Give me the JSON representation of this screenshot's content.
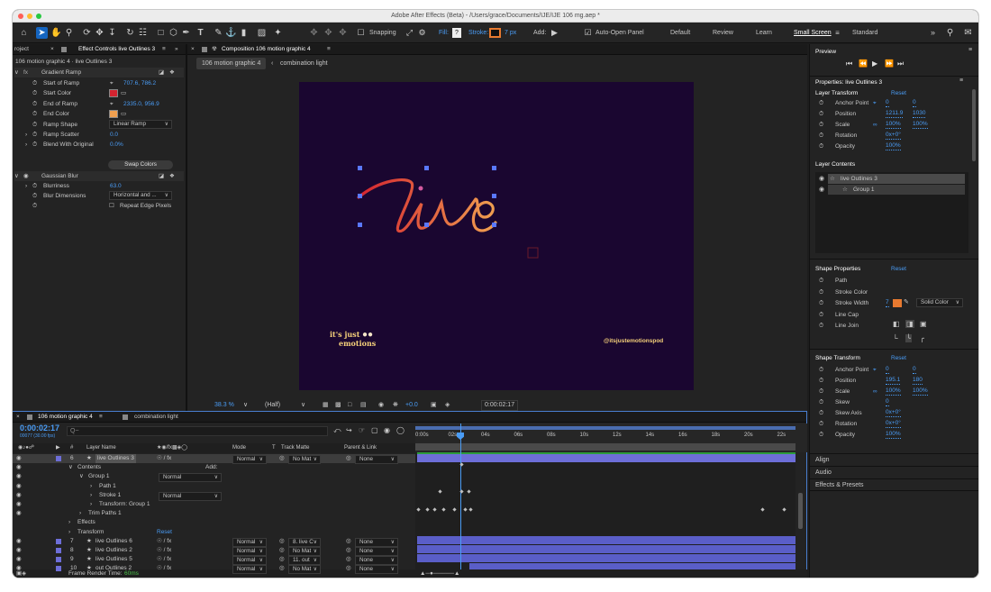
{
  "window": {
    "title": "Adobe After Effects (Beta) - /Users/grace/Documents/IJE/IJE 106 mg.aep *",
    "traffic_colors": [
      "#ff5f57",
      "#febc2e",
      "#28c840"
    ]
  },
  "toolbar": {
    "snapping": "Snapping",
    "fill_label": "Fill:",
    "fill_value": "?",
    "stroke_label": "Stroke:",
    "stroke_width": "7 px",
    "stroke_color": "#e87a30",
    "add_label": "Add:",
    "auto_open": "Auto-Open Panel",
    "workspaces": [
      "Default",
      "Review",
      "Learn",
      "Small Screen",
      "Standard"
    ],
    "active_workspace": "Small Screen",
    "more": "»"
  },
  "left_panel": {
    "project_tab": "roject",
    "tab": "Effect Controls live Outlines 3",
    "subtitle": "106 motion graphic 4 · live Outlines 3",
    "effects": [
      {
        "name": "Gradient Ramp"
      },
      {
        "name": "Gaussian Blur"
      }
    ],
    "gradient_rows": [
      {
        "label": "Start of Ramp",
        "value": "707.6, 786.2"
      },
      {
        "label": "Start Color",
        "value": ""
      },
      {
        "label": "End of Ramp",
        "value": "2335.0, 956.9"
      },
      {
        "label": "End Color",
        "value": ""
      },
      {
        "label": "Ramp Shape",
        "value": "Linear Ramp"
      },
      {
        "label": "Ramp Scatter",
        "value": "0.0"
      },
      {
        "label": "Blend With Original",
        "value": "0.0%"
      }
    ],
    "swap_colors": "Swap Colors",
    "blur_rows": [
      {
        "label": "Blurriness",
        "value": "63.0"
      },
      {
        "label": "Blur Dimensions",
        "value": "Horizontal and ..."
      },
      {
        "label": "",
        "value": "Repeat Edge Pixels"
      }
    ],
    "start_color": "#d42430",
    "end_color": "#f0a050"
  },
  "comp": {
    "tab": "Composition 106 motion graphic 4",
    "sub_tabs": [
      "106 motion graphic 4",
      "combination light"
    ],
    "live_text": "live",
    "footer_left": "it's just",
    "footer_left2": "emotions",
    "handle": "@itsjustemotionspod",
    "zoom": "38.3 %",
    "resolution": "(Half)",
    "exposure": "+0.0",
    "timecode": "0:00:02:17",
    "bg": "#1a0630"
  },
  "timeline": {
    "tabs": [
      "106 motion graphic 4",
      "combination light"
    ],
    "timecode": "0:00:02:17",
    "fps": "00077 (30.00 fps)",
    "search_placeholder": "Q~",
    "headers": {
      "num": "#",
      "name": "Layer Name",
      "mode": "Mode",
      "t": "T",
      "track": "Track Matte",
      "parent": "Parent & Link"
    },
    "ruler": [
      "0:00s",
      "02s",
      "04s",
      "06s",
      "08s",
      "10s",
      "12s",
      "14s",
      "16s",
      "18s",
      "20s",
      "22s"
    ],
    "layers_top": [
      {
        "num": "6",
        "name": "live Outlines 3",
        "mode": "Normal",
        "track": "No Mat",
        "parent": "None"
      }
    ],
    "sublayers": [
      {
        "label": "Contents",
        "extra": "Add:"
      },
      {
        "label": "Group 1",
        "mode": "Normal"
      },
      {
        "label": "Path 1"
      },
      {
        "label": "Stroke 1",
        "mode": "Normal"
      },
      {
        "label": "Transform: Group 1"
      },
      {
        "label": "Trim Paths 1"
      },
      {
        "label": "Effects"
      },
      {
        "label": "Transform",
        "extra": "Reset"
      }
    ],
    "layers_bottom": [
      {
        "num": "7",
        "name": "live Outlines 6",
        "mode": "Normal",
        "track": "8. live C",
        "parent": "None"
      },
      {
        "num": "8",
        "name": "live Outlines 2",
        "mode": "Normal",
        "track": "No Mat",
        "parent": "None"
      },
      {
        "num": "9",
        "name": "live Outlines 5",
        "mode": "Normal",
        "track": "11. out",
        "parent": "None"
      },
      {
        "num": "10",
        "name": "out Outlines 2",
        "mode": "Normal",
        "track": "No Mat",
        "parent": "None"
      }
    ],
    "frame_render": "Frame Render Time:",
    "frame_render_value": "60ms"
  },
  "right_panel": {
    "preview": "Preview",
    "properties_title": "Properties: live Outlines 3",
    "layer_transform": "Layer Transform",
    "reset": "Reset",
    "lt_rows": [
      {
        "label": "Anchor Point",
        "v1": "0",
        "v2": "0"
      },
      {
        "label": "Position",
        "v1": "1211.9",
        "v2": "1030"
      },
      {
        "label": "Scale",
        "v1": "100%",
        "v2": "100%"
      },
      {
        "label": "Rotation",
        "v1": "0x+0°",
        "v2": ""
      },
      {
        "label": "Opacity",
        "v1": "100%",
        "v2": ""
      }
    ],
    "layer_contents": "Layer Contents",
    "contents_items": [
      "live Outlines 3",
      "Group 1"
    ],
    "shape_properties": "Shape Properties",
    "sp_rows": [
      {
        "label": "Path",
        "v1": ""
      },
      {
        "label": "Stroke Color",
        "v1": "Solid Color"
      },
      {
        "label": "Stroke Width",
        "v1": "7"
      },
      {
        "label": "Line Cap",
        "v1": ""
      },
      {
        "label": "Line Join",
        "v1": ""
      }
    ],
    "shape_transform": "Shape Transform",
    "st_rows": [
      {
        "label": "Anchor Point",
        "v1": "0",
        "v2": "0"
      },
      {
        "label": "Position",
        "v1": "195.1",
        "v2": "180"
      },
      {
        "label": "Scale",
        "v1": "100%",
        "v2": "100%"
      },
      {
        "label": "Skew",
        "v1": "0",
        "v2": ""
      },
      {
        "label": "Skew Axis",
        "v1": "0x+0°",
        "v2": ""
      },
      {
        "label": "Rotation",
        "v1": "0x+0°",
        "v2": ""
      },
      {
        "label": "Opacity",
        "v1": "100%",
        "v2": ""
      }
    ],
    "collapsed": [
      "Align",
      "Audio",
      "Effects & Presets"
    ]
  }
}
